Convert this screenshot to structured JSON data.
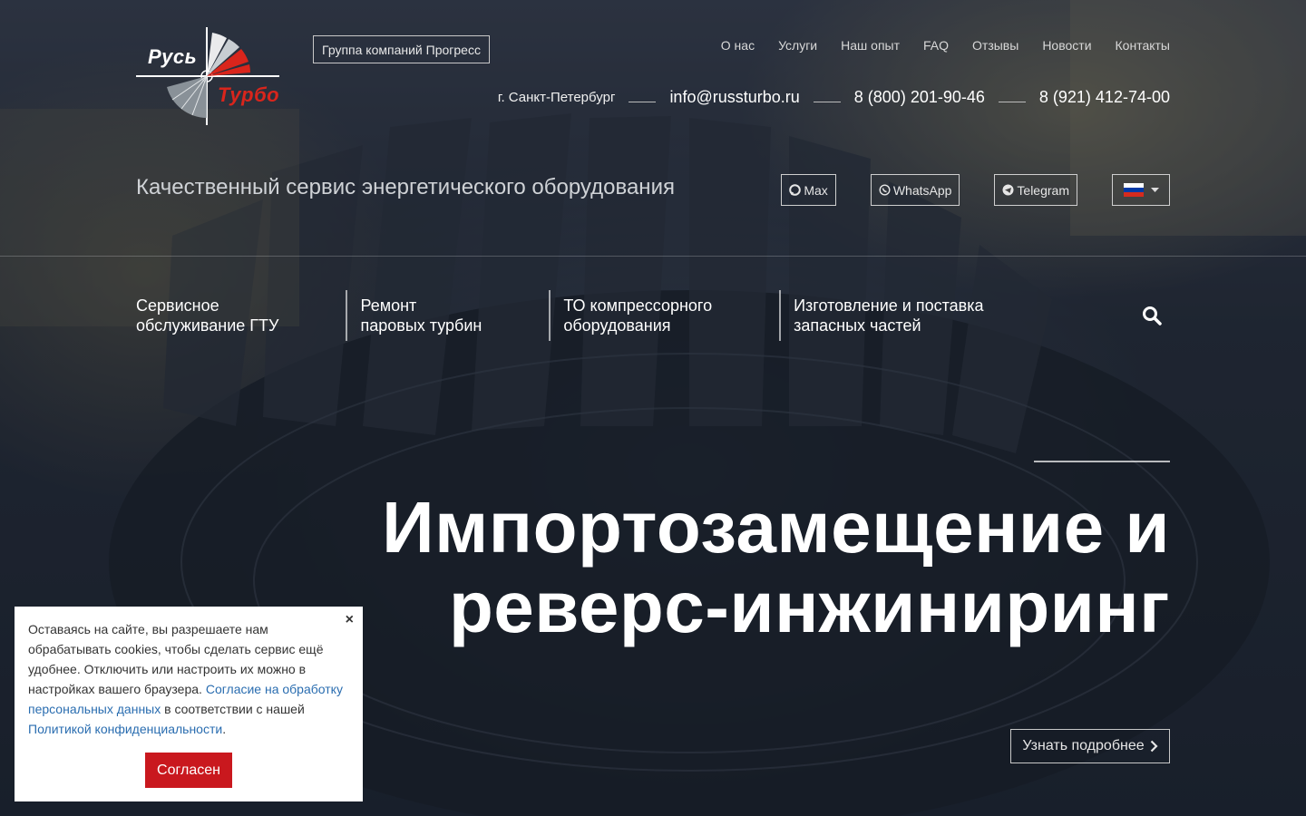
{
  "brand": {
    "name_line1": "Русь",
    "name_line2": "Турбо",
    "accent": "#d9251c"
  },
  "group_button": "Группа компаний Прогресс",
  "topnav": [
    "О нас",
    "Услуги",
    "Наш опыт",
    "FAQ",
    "Отзывы",
    "Новости",
    "Контакты"
  ],
  "contacts": {
    "city": "г. Санкт-Петербург",
    "email": "info@russturbo.ru",
    "phone1": "8 (800) 201-90-46",
    "phone2": "8 (921) 412-74-00"
  },
  "tagline": "Качественный сервис энергетического оборудования",
  "messengers": {
    "max": "Max",
    "whatsapp": "WhatsApp",
    "telegram": "Telegram"
  },
  "language": {
    "flag_colors": [
      "#ffffff",
      "#0039a6",
      "#d52b1e"
    ],
    "icon": "chevron-down-icon"
  },
  "services": [
    {
      "line1": "Сервисное",
      "line2": "обслуживание ГТУ"
    },
    {
      "line1": "Ремонт",
      "line2": "паровых турбин"
    },
    {
      "line1": "ТО компрессорного",
      "line2": "оборудования"
    },
    {
      "line1": "Изготовление и поставка",
      "line2": "запасных частей"
    }
  ],
  "hero": {
    "line1": "Импортозамещение и",
    "line2": "реверс-инжиниринг",
    "button": "Узнать подробнее"
  },
  "cookie": {
    "text1": "Оставаясь на сайте, вы разрешаете нам обрабатывать cookies, чтобы сделать сервис ещё удобнее. Отключить или настроить их можно в настройках вашего браузера. ",
    "link1": "Согласие на обработку персональных данных",
    "text2": " в соответствии с нашей ",
    "link2": "Политикой конфиденциальности",
    "text3": ".",
    "close": "×",
    "agree": "Согласен",
    "agree_color": "#c9181e"
  }
}
